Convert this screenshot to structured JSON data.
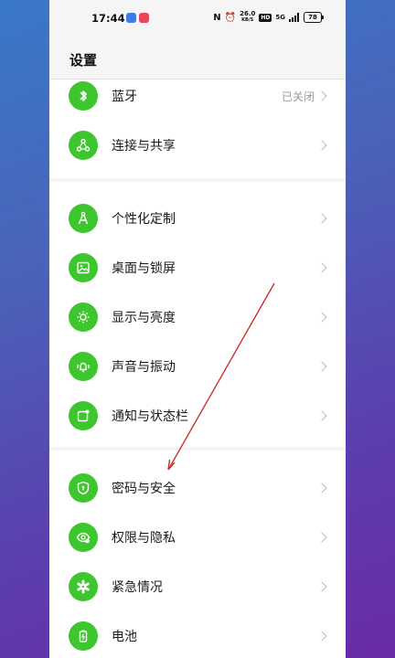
{
  "status_bar": {
    "time": "17:44",
    "net_speed": "26.0",
    "net_unit": "KB/S",
    "hd": "HD",
    "signal": "5G",
    "battery": "78"
  },
  "page": {
    "title": "设置"
  },
  "groups": [
    {
      "items": [
        {
          "label": "蓝牙",
          "value": "已关闭",
          "icon": "bluetooth-icon"
        },
        {
          "label": "连接与共享",
          "icon": "share-nodes-icon"
        }
      ]
    },
    {
      "items": [
        {
          "label": "个性化定制",
          "icon": "compass-icon"
        },
        {
          "label": "桌面与锁屏",
          "icon": "image-icon"
        },
        {
          "label": "显示与亮度",
          "icon": "sun-icon"
        },
        {
          "label": "声音与振动",
          "icon": "bell-vibrate-icon"
        },
        {
          "label": "通知与状态栏",
          "icon": "notification-icon"
        }
      ]
    },
    {
      "items": [
        {
          "label": "密码与安全",
          "icon": "shield-lock-icon"
        },
        {
          "label": "权限与隐私",
          "icon": "eye-privacy-icon"
        },
        {
          "label": "紧急情况",
          "icon": "emergency-icon"
        },
        {
          "label": "电池",
          "icon": "battery-icon"
        }
      ]
    }
  ],
  "colors": {
    "accent_green": "#3dc62e",
    "annotation_arrow": "#c8322d"
  }
}
